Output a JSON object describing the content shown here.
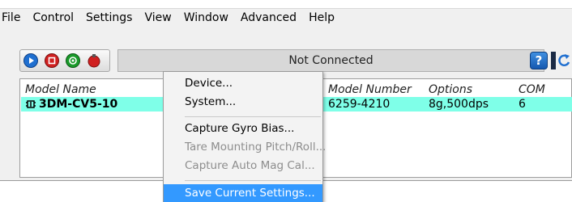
{
  "menubar": [
    "File",
    "Control",
    "Settings",
    "View",
    "Window",
    "Advanced",
    "Help"
  ],
  "toolbar": {
    "status_text": "Not Connected",
    "help_label": "?",
    "buttons": [
      {
        "name": "play-icon",
        "color": "#1f6fd0"
      },
      {
        "name": "stop-icon",
        "color": "#d02020"
      },
      {
        "name": "record-icon",
        "color": "#1a9a2a"
      },
      {
        "name": "idle-icon",
        "color": "#d02020"
      }
    ]
  },
  "table": {
    "columns": [
      "Model Name",
      "Model Number",
      "Options",
      "COM"
    ],
    "row": {
      "icon": "sensor-icon",
      "model_name": "3DM-CV5-10",
      "model_number": "6259-4210",
      "options": "8g,500dps",
      "com": "6"
    },
    "highlight_color": "#7fffe8"
  },
  "context_menu": {
    "items": [
      {
        "label": "Device...",
        "enabled": true
      },
      {
        "label": "System...",
        "enabled": true
      },
      {
        "label": "Capture Gyro Bias...",
        "enabled": true
      },
      {
        "label": "Tare Mounting Pitch/Roll...",
        "enabled": false
      },
      {
        "label": "Capture Auto Mag Cal...",
        "enabled": false
      },
      {
        "label": "Save Current Settings...",
        "enabled": true,
        "highlighted": true
      }
    ],
    "highlight_color": "#3399ff"
  }
}
